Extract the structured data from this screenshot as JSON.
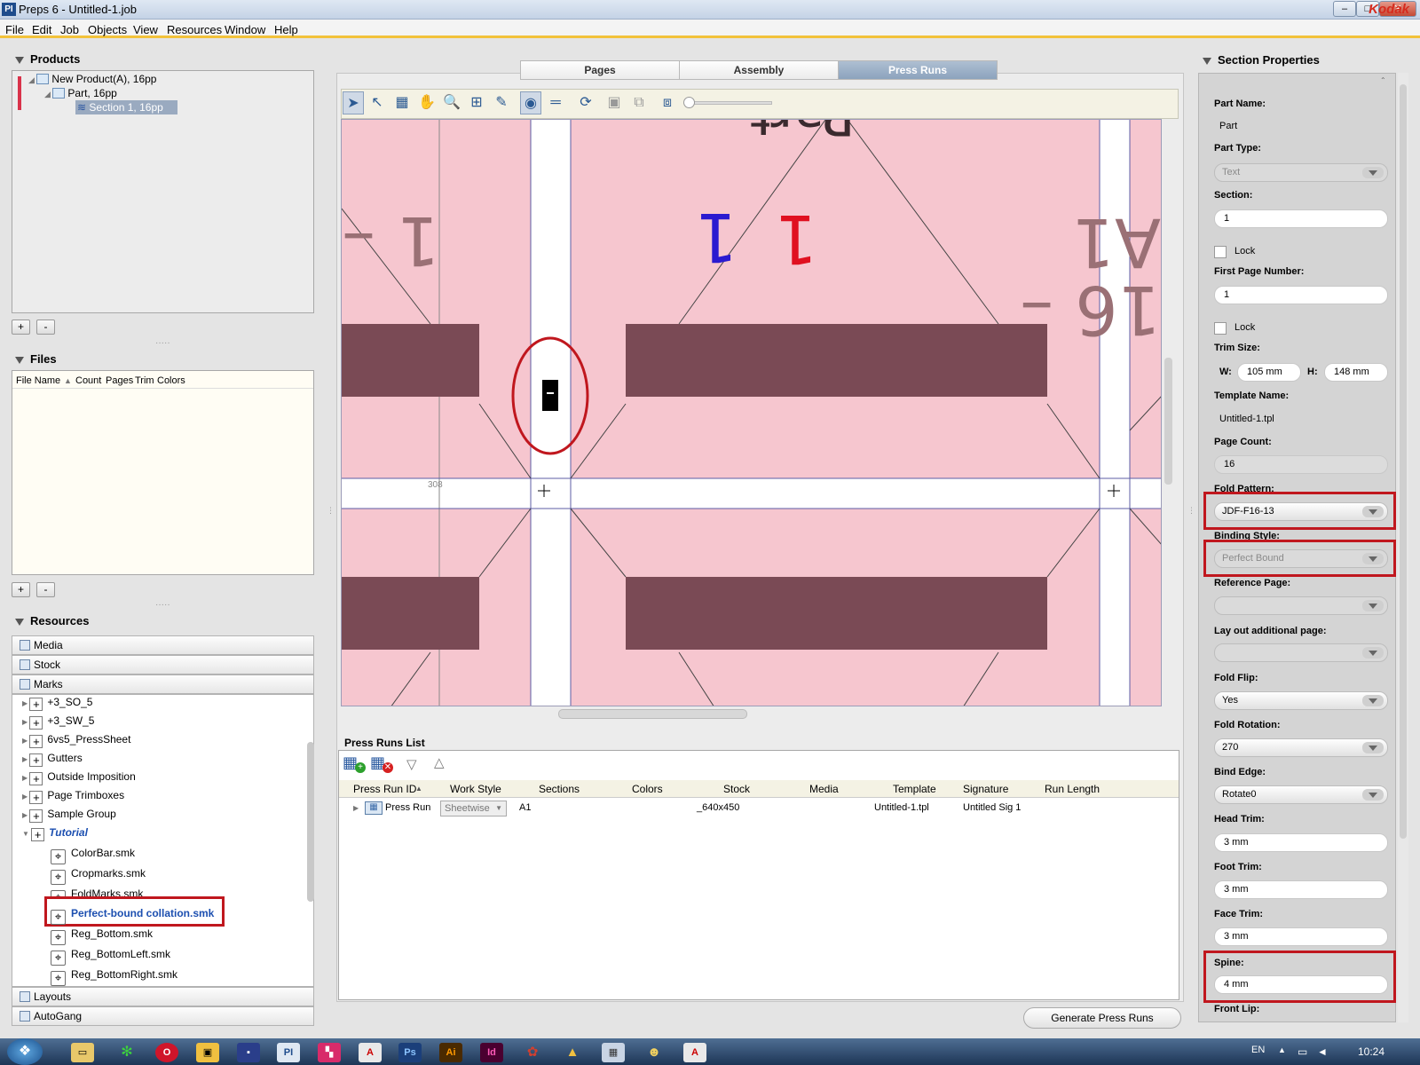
{
  "window": {
    "title": "Preps 6 - Untitled-1.job",
    "app_icon": "PI",
    "buttons": [
      "–",
      "□",
      "✕"
    ]
  },
  "menu": {
    "items": [
      "File",
      "Edit",
      "Job",
      "Objects",
      "View",
      "Resources",
      "Window",
      "Help"
    ],
    "brand": "Kodak"
  },
  "products": {
    "header": "Products",
    "tree": [
      "New Product(A), 16pp",
      "Part, 16pp",
      "Section 1, 16pp"
    ],
    "add": "+",
    "remove": "-"
  },
  "files": {
    "header": "Files",
    "columns": [
      "File Name",
      "Count",
      "Pages",
      "Trim",
      "Colors"
    ],
    "add": "+",
    "remove": "-"
  },
  "resources": {
    "header": "Resources",
    "tabs": [
      "Media",
      "Stock",
      "Marks",
      "Layouts",
      "AutoGang"
    ],
    "groups": [
      "+3_SO_5",
      "+3_SW_5",
      "6vs5_PressSheet",
      "Gutters",
      "Outside Imposition",
      "Page Trimboxes",
      "Sample Group",
      "Tutorial"
    ],
    "marks": [
      "ColorBar.smk",
      "Cropmarks.smk",
      "FoldMarks.smk",
      "Perfect-bound collation.smk",
      "Reg_Bottom.smk",
      "Reg_BottomLeft.smk",
      "Reg_BottomRight.smk"
    ]
  },
  "tabs": [
    "Pages",
    "Assembly",
    "Press Runs"
  ],
  "active_tab": "Press Runs",
  "canvas": {
    "page_text": "16 – A1",
    "page_text_left": "1 –",
    "page_top_text": "Part",
    "ruler_label": "308"
  },
  "press_runs": {
    "header": "Press Runs List",
    "columns": [
      "Press Run ID",
      "Work Style",
      "Sections",
      "Colors",
      "Stock",
      "Media",
      "Template",
      "Signature",
      "Run Length"
    ],
    "row": {
      "id": "Press Run",
      "work_style": "Sheetwise",
      "sections": "A1",
      "colors": "",
      "stock": "_640x450",
      "media": "",
      "template": "Untitled-1.tpl",
      "signature": "Untitled Sig 1",
      "run_length": ""
    },
    "generate_button": "Generate Press Runs"
  },
  "section_properties": {
    "header": "Section Properties",
    "part_name_label": "Part Name:",
    "part_name": "Part",
    "part_type_label": "Part Type:",
    "part_type": "Text",
    "section_label": "Section:",
    "section": "1",
    "lock_label": "Lock",
    "first_page_label": "First Page Number:",
    "first_page": "1",
    "trim_size_label": "Trim Size:",
    "w_label": "W:",
    "w": "105 mm",
    "h_label": "H:",
    "h": "148 mm",
    "template_label": "Template Name:",
    "template": "Untitled-1.tpl",
    "page_count_label": "Page Count:",
    "page_count": "16",
    "fold_pattern_label": "Fold Pattern:",
    "fold_pattern": "JDF-F16-13",
    "binding_style_label": "Binding Style:",
    "binding_style": "Perfect Bound",
    "reference_page_label": "Reference Page:",
    "reference_page": "",
    "layout_additional_label": "Lay out additional page:",
    "layout_additional": "",
    "fold_flip_label": "Fold Flip:",
    "fold_flip": "Yes",
    "fold_rotation_label": "Fold Rotation:",
    "fold_rotation": "270",
    "bind_edge_label": "Bind Edge:",
    "bind_edge": "Rotate0",
    "head_trim_label": "Head Trim:",
    "head_trim": "3 mm",
    "foot_trim_label": "Foot Trim:",
    "foot_trim": "3 mm",
    "face_trim_label": "Face Trim:",
    "face_trim": "3 mm",
    "spine_label": "Spine:",
    "spine": "4 mm",
    "front_lip_label": "Front Lip:"
  },
  "taskbar": {
    "lang": "EN",
    "time": "10:24",
    "start": "❖",
    "apps": [
      "explorer",
      "green",
      "opera",
      "media",
      "save",
      "preps",
      "grid",
      "acrobat",
      "photoshop",
      "illustrator",
      "indesign",
      "gift",
      "cap",
      "calc",
      "user",
      "pdf"
    ],
    "labels": {
      "ps": "Ps",
      "ai": "Ai",
      "id": "Id",
      "pi": "PI"
    }
  },
  "colors": {
    "accent": "#f2c23a",
    "highlight": "#c0171e",
    "page": "#f6c6cf",
    "bar": "#7a4a55",
    "blue_digit": "#2a1ad0",
    "red_digit": "#e01020"
  }
}
